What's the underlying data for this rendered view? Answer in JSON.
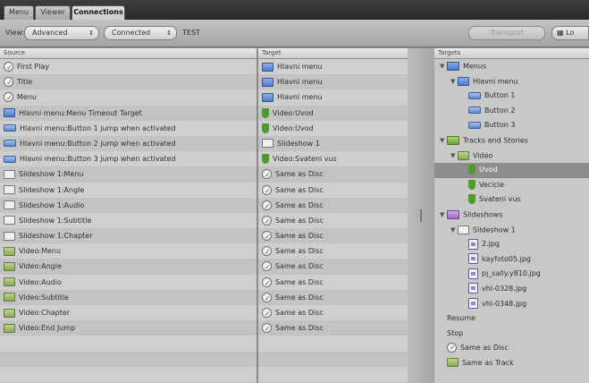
{
  "tabs": [
    "Menu",
    "Viewer",
    "Connections"
  ],
  "toolbar": {
    "view_label": "View:",
    "view_value": "Advanced",
    "filter_value": "Connected",
    "test_text": "TEST",
    "transport_label": "Transport",
    "cut_button": "Lo"
  },
  "source": {
    "header": "Source",
    "rows": [
      {
        "icon": "check",
        "label": "First Play"
      },
      {
        "icon": "check",
        "label": "Title"
      },
      {
        "icon": "check",
        "label": "Menu"
      },
      {
        "icon": "menu",
        "label": "Hlavni menu:Menu Timeout Target"
      },
      {
        "icon": "btn",
        "label": "Hlavni menu:Button 1 jump when activated"
      },
      {
        "icon": "btn",
        "label": "Hlavni menu:Button 2 jump when activated"
      },
      {
        "icon": "btn",
        "label": "Hlavni menu:Button 3 jump when activated"
      },
      {
        "icon": "slide",
        "label": "Slideshow 1:Menu"
      },
      {
        "icon": "slide",
        "label": "Slideshow 1:Angle"
      },
      {
        "icon": "slide",
        "label": "Slideshow 1:Audio"
      },
      {
        "icon": "slide",
        "label": "Slideshow 1:Subtitle"
      },
      {
        "icon": "slide",
        "label": "Slideshow 1:Chapter"
      },
      {
        "icon": "vid",
        "label": "Video:Menu"
      },
      {
        "icon": "vid",
        "label": "Video:Angle"
      },
      {
        "icon": "vid",
        "label": "Video:Audio"
      },
      {
        "icon": "vid",
        "label": "Video:Subtitle"
      },
      {
        "icon": "vid",
        "label": "Video:Chapter"
      },
      {
        "icon": "vid",
        "label": "Video:End Jump"
      }
    ]
  },
  "target": {
    "header": "Target",
    "rows": [
      {
        "icon": "menu",
        "label": "Hlavni menu"
      },
      {
        "icon": "menu",
        "label": "Hlavni menu"
      },
      {
        "icon": "menu",
        "label": "Hlavni menu"
      },
      {
        "icon": "shield",
        "label": "Video:Uvod"
      },
      {
        "icon": "shield",
        "label": "Video:Uvod"
      },
      {
        "icon": "slide",
        "label": "Slideshow 1"
      },
      {
        "icon": "shield",
        "label": "Video:Svateni vus"
      },
      {
        "icon": "check",
        "label": "Same as Disc"
      },
      {
        "icon": "check",
        "label": "Same as Disc"
      },
      {
        "icon": "check",
        "label": "Same as Disc"
      },
      {
        "icon": "check",
        "label": "Same as Disc"
      },
      {
        "icon": "check",
        "label": "Same as Disc"
      },
      {
        "icon": "check",
        "label": "Same as Disc"
      },
      {
        "icon": "check",
        "label": "Same as Disc"
      },
      {
        "icon": "check",
        "label": "Same as Disc"
      },
      {
        "icon": "check",
        "label": "Same as Disc"
      },
      {
        "icon": "check",
        "label": "Same as Disc"
      },
      {
        "icon": "check",
        "label": "Same as Disc"
      }
    ]
  },
  "targets_tree": {
    "header": "Targets",
    "items": [
      {
        "indent": 0,
        "disclosure": "▼",
        "icon": "f-blue",
        "label": "Menus"
      },
      {
        "indent": 1,
        "disclosure": "▼",
        "icon": "menu",
        "label": "Hlavni menu"
      },
      {
        "indent": 2,
        "disclosure": "",
        "icon": "btn",
        "label": "Button 1"
      },
      {
        "indent": 2,
        "disclosure": "",
        "icon": "btn",
        "label": "Button 2"
      },
      {
        "indent": 2,
        "disclosure": "",
        "icon": "btn",
        "label": "Button 3"
      },
      {
        "indent": 0,
        "disclosure": "▼",
        "icon": "f-green",
        "label": "Tracks and Stories"
      },
      {
        "indent": 1,
        "disclosure": "▼",
        "icon": "vid",
        "label": "Video"
      },
      {
        "indent": 2,
        "disclosure": "",
        "icon": "shield",
        "label": "Uvod",
        "selected": true
      },
      {
        "indent": 2,
        "disclosure": "",
        "icon": "shield",
        "label": "Vecicle"
      },
      {
        "indent": 2,
        "disclosure": "",
        "icon": "shield",
        "label": "Svateni vus"
      },
      {
        "indent": 0,
        "disclosure": "▼",
        "icon": "f-purple",
        "label": "Slideshows"
      },
      {
        "indent": 1,
        "disclosure": "▼",
        "icon": "slide",
        "label": "Slideshow 1"
      },
      {
        "indent": 2,
        "disclosure": "",
        "icon": "img",
        "label": "2.jpg"
      },
      {
        "indent": 2,
        "disclosure": "",
        "icon": "img",
        "label": "kayfoto05.jpg"
      },
      {
        "indent": 2,
        "disclosure": "",
        "icon": "img",
        "label": "pj_sally.y810.jpg"
      },
      {
        "indent": 2,
        "disclosure": "",
        "icon": "img",
        "label": "vhl-0328.jpg"
      },
      {
        "indent": 2,
        "disclosure": "",
        "icon": "img",
        "label": "vhl-0348.jpg"
      },
      {
        "indent": 0,
        "disclosure": "",
        "icon": "none",
        "label": "Resume"
      },
      {
        "indent": 0,
        "disclosure": "",
        "icon": "none",
        "label": "Stop"
      },
      {
        "indent": 0,
        "disclosure": "",
        "icon": "check",
        "label": "Same as Disc"
      },
      {
        "indent": 0,
        "disclosure": "",
        "icon": "vid",
        "label": "Same as Track"
      }
    ]
  }
}
